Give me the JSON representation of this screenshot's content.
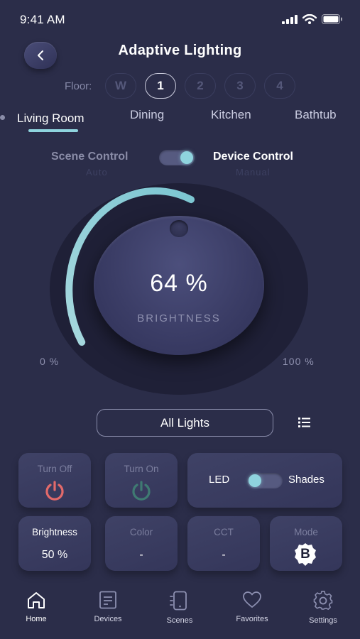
{
  "status_bar": {
    "time": "9:41 AM"
  },
  "header": {
    "title": "Adaptive Lighting"
  },
  "floor": {
    "label": "Floor:",
    "options": [
      "W",
      "1",
      "2",
      "3",
      "4"
    ],
    "selected": "1"
  },
  "rooms": {
    "tabs": [
      "Living Room",
      "Dining",
      "Kitchen",
      "Bathtub"
    ],
    "selected": "Living Room"
  },
  "mode": {
    "left_label": "Scene Control",
    "left_sub": "Auto",
    "right_label": "Device Control",
    "right_sub": "Manual",
    "state": "Device Control"
  },
  "dial": {
    "value_text": "64 %",
    "label": "BRIGHTNESS",
    "min_label": "0 %",
    "max_label": "100 %",
    "level": 0.64
  },
  "group_selector": {
    "label": "All Lights"
  },
  "tiles": {
    "turn_off": {
      "label": "Turn Off"
    },
    "turn_on": {
      "label": "Turn On"
    },
    "led_shades": {
      "left": "LED",
      "right": "Shades",
      "state": "LED"
    },
    "brightness": {
      "label": "Brightness",
      "value": "50 %"
    },
    "color": {
      "label": "Color",
      "value": "-"
    },
    "cct": {
      "label": "CCT",
      "value": "-"
    },
    "mode": {
      "label": "Mode",
      "value": "B"
    }
  },
  "nav": {
    "items": [
      {
        "label": "Home",
        "icon": "home-icon"
      },
      {
        "label": "Devices",
        "icon": "devices-icon"
      },
      {
        "label": "Scenes",
        "icon": "scenes-icon"
      },
      {
        "label": "Favorites",
        "icon": "heart-icon"
      },
      {
        "label": "Settings",
        "icon": "gear-icon"
      }
    ],
    "selected": "Home"
  },
  "colors": {
    "background": "#2b2d49",
    "accent": "#8fd4de",
    "power_off": "#e26a6a",
    "power_on": "#3f7a72"
  }
}
